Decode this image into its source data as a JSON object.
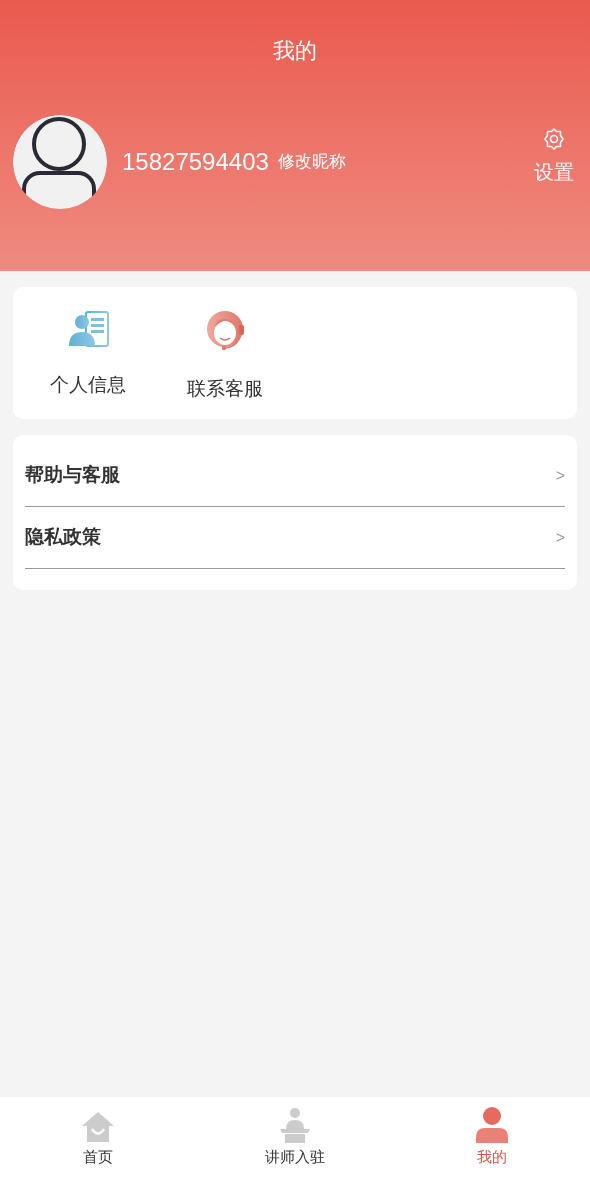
{
  "header": {
    "title": "我的",
    "phone": "15827594403",
    "edit_nickname": "修改昵称",
    "settings": "设置"
  },
  "shortcuts": [
    {
      "kind": "profile",
      "label": "个人信息"
    },
    {
      "kind": "support",
      "label": "联系客服"
    }
  ],
  "menu": [
    {
      "label": "帮助与客服",
      "arrow": ">"
    },
    {
      "label": "隐私政策",
      "arrow": ">"
    }
  ],
  "tabs": [
    {
      "kind": "home",
      "label": "首页",
      "selected": false
    },
    {
      "kind": "lecturer",
      "label": "讲师入驻",
      "selected": false
    },
    {
      "kind": "me",
      "label": "我的",
      "selected": true
    }
  ]
}
